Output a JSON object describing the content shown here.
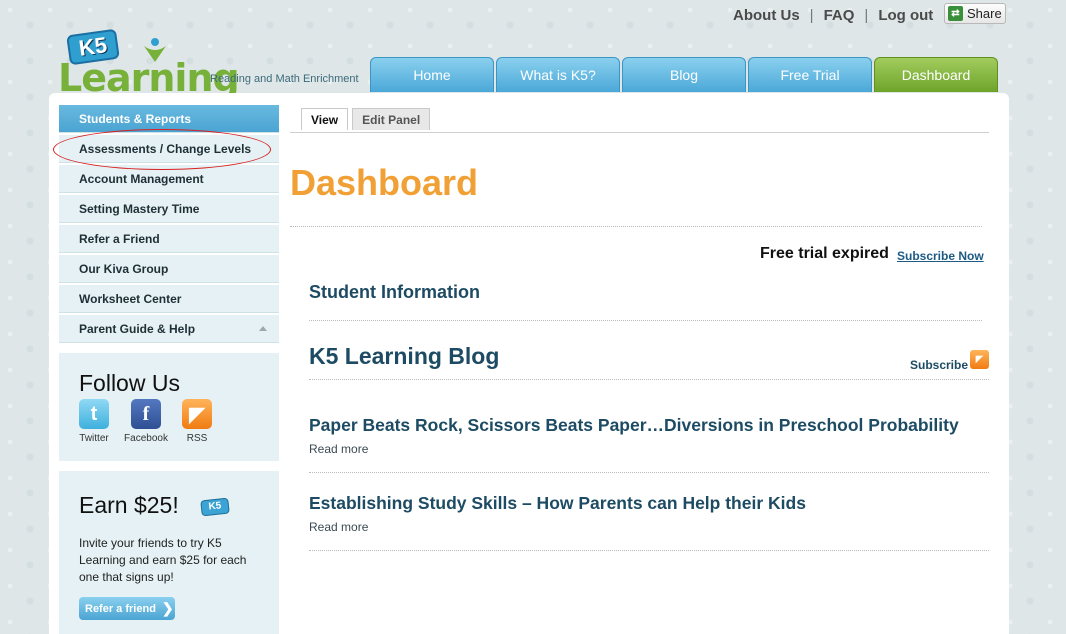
{
  "toplinks": {
    "about": "About Us",
    "faq": "FAQ",
    "logout": "Log out",
    "sep": "|",
    "share": "Share"
  },
  "logo": {
    "badge": "K5",
    "word": "Learning",
    "tagline": "Reading and Math Enrichment"
  },
  "nav": [
    "Home",
    "What is K5?",
    "Blog",
    "Free Trial",
    "Dashboard"
  ],
  "sidebar": {
    "items": [
      "Students & Reports",
      "Assessments / Change Levels",
      "Account Management",
      "Setting Mastery Time",
      "Refer a Friend",
      "Our Kiva Group",
      "Worksheet Center",
      "Parent Guide & Help"
    ]
  },
  "follow": {
    "title": "Follow Us",
    "twitter": "Twitter",
    "facebook": "Facebook",
    "rss": "RSS"
  },
  "earn": {
    "title": "Earn $25!",
    "badge": "K5",
    "text": "Invite your friends to try K5 Learning and earn $25 for each one that signs up!",
    "button": "Refer a friend"
  },
  "content_tabs": {
    "view": "View",
    "edit": "Edit Panel"
  },
  "main": {
    "title": "Dashboard",
    "trial_text": "Free trial expired",
    "subscribe_now": "Subscribe Now",
    "student_info": "Student Information",
    "blog_heading": "K5 Learning Blog",
    "blog_subscribe": "Subscribe",
    "posts": [
      {
        "title": "Paper Beats Rock, Scissors Beats Paper…Diversions in Preschool Probability",
        "more": "Read more"
      },
      {
        "title": "Establishing Study Skills – How Parents can Help their Kids",
        "more": "Read more"
      }
    ]
  },
  "colors": {
    "accent_orange": "#f0a035",
    "nav_blue": "#4ba8d8",
    "nav_active_green": "#6ea42a",
    "highlight_red": "#d8201f"
  }
}
